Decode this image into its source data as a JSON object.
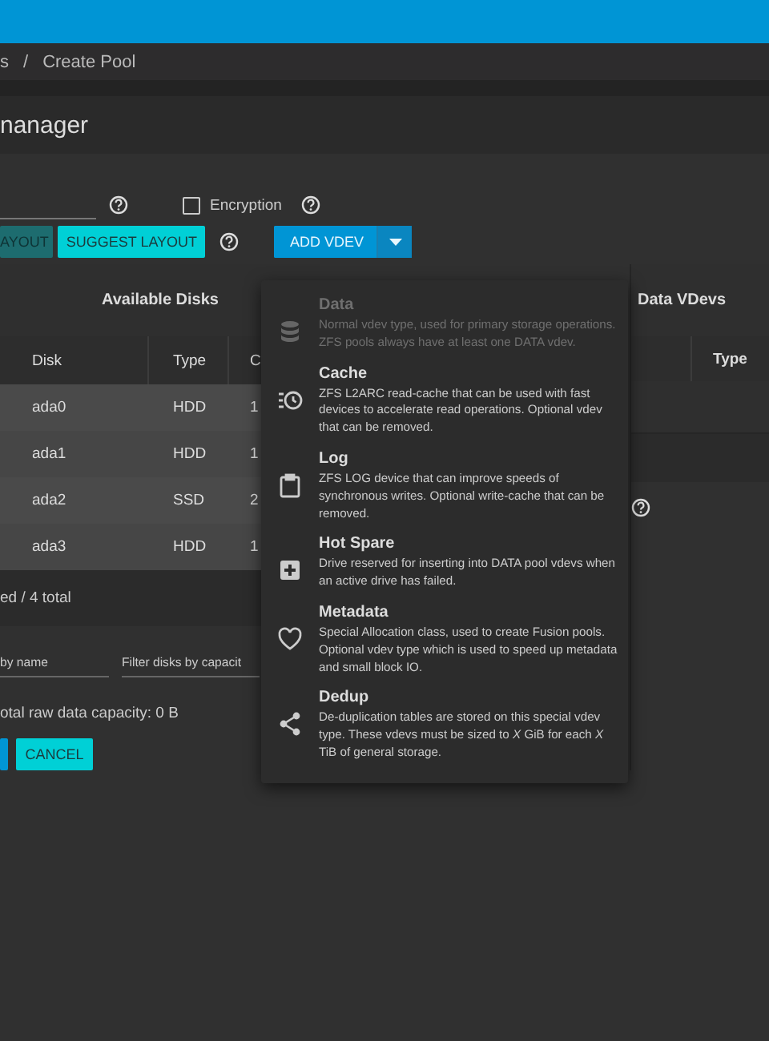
{
  "breadcrumb": {
    "items": [
      "s",
      "Create Pool"
    ],
    "separator": "/"
  },
  "page_title": "nanager",
  "encryption": {
    "label": "Encryption",
    "checked": false
  },
  "layout_buttons": [
    {
      "label": "AYOUT",
      "kind": "dim"
    },
    {
      "label": "SUGGEST LAYOUT",
      "kind": "accent"
    }
  ],
  "add_vdev": {
    "label": "ADD VDEV",
    "expanded": true
  },
  "available_disks": {
    "title": "Available Disks",
    "columns": [
      "Disk",
      "Type",
      "C"
    ],
    "rows": [
      [
        "ada0",
        "HDD",
        "1"
      ],
      [
        "ada1",
        "HDD",
        "1"
      ],
      [
        "ada2",
        "SSD",
        "2"
      ],
      [
        "ada3",
        "HDD",
        "1"
      ]
    ],
    "footer": "ed / 4 total"
  },
  "filters": [
    {
      "placeholder": "by name"
    },
    {
      "placeholder": "Filter disks by capacit"
    }
  ],
  "capacity": "otal raw data capacity: 0 B",
  "actions": [
    {
      "kind": "primary"
    },
    {
      "label": "CANCEL",
      "kind": "accent"
    }
  ],
  "data_vdevs": {
    "title": "Data VDevs",
    "columns": [
      "Type"
    ]
  },
  "vdev_menu": [
    {
      "kind": "data",
      "title": "Data",
      "description": "Normal vdev type, used for primary storage operations. ZFS pools always have at least one DATA vdev.",
      "disabled": true
    },
    {
      "kind": "cache",
      "title": "Cache",
      "description": "ZFS L2ARC read-cache that can be used with fast devices to accelerate read operations. Optional vdev that can be removed.",
      "disabled": false
    },
    {
      "kind": "log",
      "title": "Log",
      "description": "ZFS LOG device that can improve speeds of synchronous writes. Optional write-cache that can be removed.",
      "disabled": false
    },
    {
      "kind": "spare",
      "title": "Hot Spare",
      "description": "Drive reserved for inserting into DATA pool vdevs when an active drive has failed.",
      "disabled": false
    },
    {
      "kind": "metadata",
      "title": "Metadata",
      "description": "Special Allocation class, used to create Fusion pools. Optional vdev type which is used to speed up metadata and small block IO.",
      "disabled": false
    },
    {
      "kind": "dedup",
      "title": "Dedup",
      "description": "De-duplication tables are stored on this special vdev type. These vdevs must be sized to *X* GiB for each *X* TiB of general storage.",
      "disabled": false
    }
  ]
}
